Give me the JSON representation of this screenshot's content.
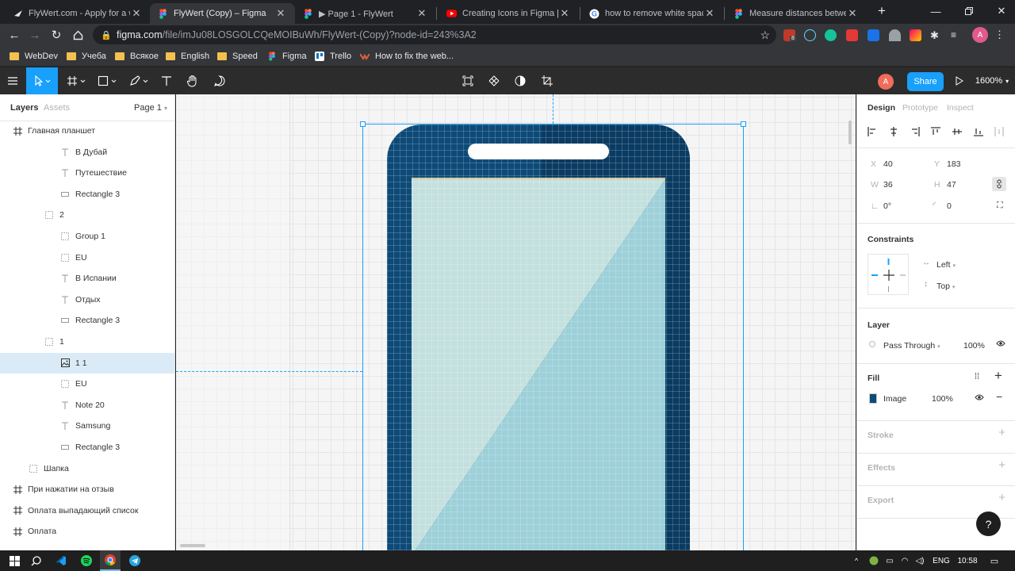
{
  "browser": {
    "tabs": [
      {
        "title": "FlyWert.com - Apply for a wo",
        "icon": "flywert-icon",
        "active": false
      },
      {
        "title": "FlyWert (Copy) – Figma",
        "icon": "figma-icon",
        "active": true
      },
      {
        "title": "▶ Page 1 - FlyWert",
        "icon": "figma-icon",
        "active": false
      },
      {
        "title": "Creating Icons in Figma [Tuto",
        "icon": "youtube-icon",
        "active": false
      },
      {
        "title": "how to remove white spaces",
        "icon": "google-icon",
        "active": false
      },
      {
        "title": "Measure distances between",
        "icon": "figma-icon",
        "active": false
      }
    ],
    "new_tab": "+",
    "url_host": "figma.com",
    "url_path": "/file/imJu08LOSGOLCQeMOIBuWh/FlyWert-(Copy)?node-id=243%3A2",
    "extension_badge": "8",
    "profile_initial": "A",
    "bookmarks": [
      {
        "label": "WebDev",
        "type": "folder"
      },
      {
        "label": "Учеба",
        "type": "folder"
      },
      {
        "label": "Всякое",
        "type": "folder"
      },
      {
        "label": "English",
        "type": "folder"
      },
      {
        "label": "Speed",
        "type": "folder"
      },
      {
        "label": "Figma",
        "type": "figma-icon"
      },
      {
        "label": "Trello",
        "type": "trello-icon"
      },
      {
        "label": "How to fix the web...",
        "type": "site-icon"
      }
    ]
  },
  "figma": {
    "zoom": "1600%",
    "share_label": "Share",
    "user_initial": "A",
    "left_panel": {
      "tabs": [
        "Layers",
        "Assets"
      ],
      "page": "Page 1",
      "layers": [
        {
          "label": "Главная планшет",
          "icon": "frame-icon",
          "indent": 0
        },
        {
          "label": "В Дубай",
          "icon": "text-icon",
          "indent": 3
        },
        {
          "label": "Путешествие",
          "icon": "text-icon",
          "indent": 3
        },
        {
          "label": "Rectangle 3",
          "icon": "rectangle-icon",
          "indent": 3
        },
        {
          "label": "2",
          "icon": "group-icon",
          "indent": 2
        },
        {
          "label": "Group 1",
          "icon": "group-icon",
          "indent": 3
        },
        {
          "label": "EU",
          "icon": "group-icon",
          "indent": 3
        },
        {
          "label": "В Испании",
          "icon": "text-icon",
          "indent": 3
        },
        {
          "label": "Отдых",
          "icon": "text-icon",
          "indent": 3
        },
        {
          "label": "Rectangle 3",
          "icon": "rectangle-icon",
          "indent": 3
        },
        {
          "label": "1",
          "icon": "group-icon",
          "indent": 2
        },
        {
          "label": "1 1",
          "icon": "image-icon",
          "indent": 3,
          "selected": true
        },
        {
          "label": "EU",
          "icon": "group-icon",
          "indent": 3
        },
        {
          "label": "Note 20",
          "icon": "text-icon",
          "indent": 3
        },
        {
          "label": "Samsung",
          "icon": "text-icon",
          "indent": 3
        },
        {
          "label": "Rectangle 3",
          "icon": "rectangle-icon",
          "indent": 3
        },
        {
          "label": "Шапка",
          "icon": "group-icon",
          "indent": 1
        },
        {
          "label": "При нажатии на отзыв",
          "icon": "frame-icon",
          "indent": 0
        },
        {
          "label": "Оплата выпадающий список",
          "icon": "frame-icon",
          "indent": 0
        },
        {
          "label": "Оплата",
          "icon": "frame-icon",
          "indent": 0
        }
      ]
    },
    "right_panel": {
      "tabs": [
        "Design",
        "Prototype",
        "Inspect"
      ],
      "x": "40",
      "y": "183",
      "w": "36",
      "h": "47",
      "rotation": "0°",
      "radius": "0",
      "x_label": "X",
      "y_label": "Y",
      "w_label": "W",
      "h_label": "H",
      "constraints_title": "Constraints",
      "constraint_h": "Left",
      "constraint_v": "Top",
      "layer_title": "Layer",
      "blend_mode": "Pass Through",
      "opacity": "100%",
      "fill_title": "Fill",
      "fill_type": "Image",
      "fill_opacity": "100%",
      "stroke_title": "Stroke",
      "effects_title": "Effects",
      "export_title": "Export",
      "help": "?"
    }
  },
  "taskbar": {
    "lang": "ENG",
    "time": "10:58"
  },
  "colors": {
    "accent": "#18a0fb",
    "phone_body": "#0d4a78",
    "screen_light": "#c3e0de",
    "screen_dark": "#9dd0d9"
  }
}
